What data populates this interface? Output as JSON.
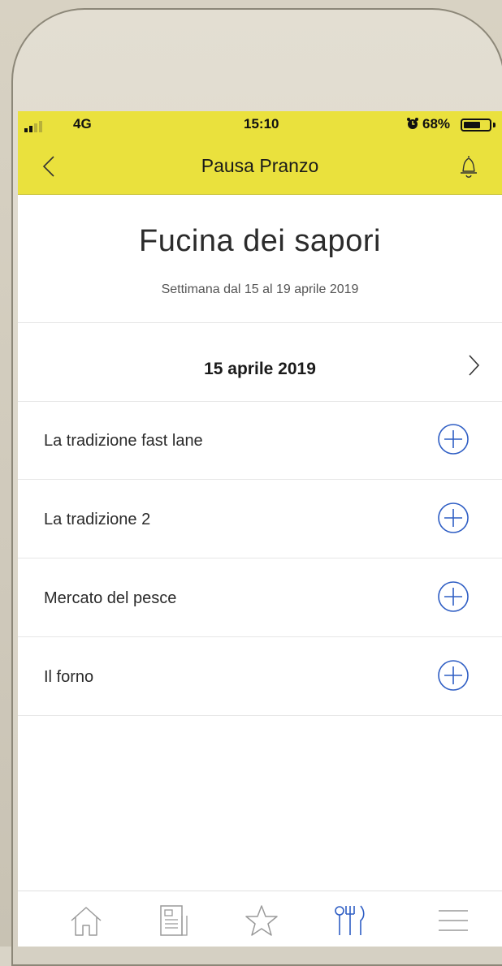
{
  "status_bar": {
    "network": "4G",
    "time": "15:10",
    "battery_percent": "68%",
    "battery_level": 0.68
  },
  "nav": {
    "title": "Pausa Pranzo",
    "back_icon": "chevron-left-icon",
    "bell_icon": "bell-icon"
  },
  "restaurant": {
    "name": "Fucina dei sapori",
    "week": "Settimana dal 15 al 19 aprile 2019"
  },
  "day": {
    "date": "15 aprile 2019",
    "next_icon": "chevron-right-icon"
  },
  "menu_items": [
    {
      "label": "La tradizione fast lane"
    },
    {
      "label": "La tradizione 2"
    },
    {
      "label": "Mercato del pesce"
    },
    {
      "label": "Il forno"
    }
  ],
  "tabs": [
    {
      "icon": "home-icon",
      "active": false
    },
    {
      "icon": "news-icon",
      "active": false
    },
    {
      "icon": "star-icon",
      "active": false
    },
    {
      "icon": "restaurant-icon",
      "active": true
    },
    {
      "icon": "menu-icon",
      "active": false
    }
  ],
  "colors": {
    "accent_yellow": "#eae13d",
    "action_blue": "#2f5ec4",
    "inactive_gray": "#9a9a9a"
  }
}
